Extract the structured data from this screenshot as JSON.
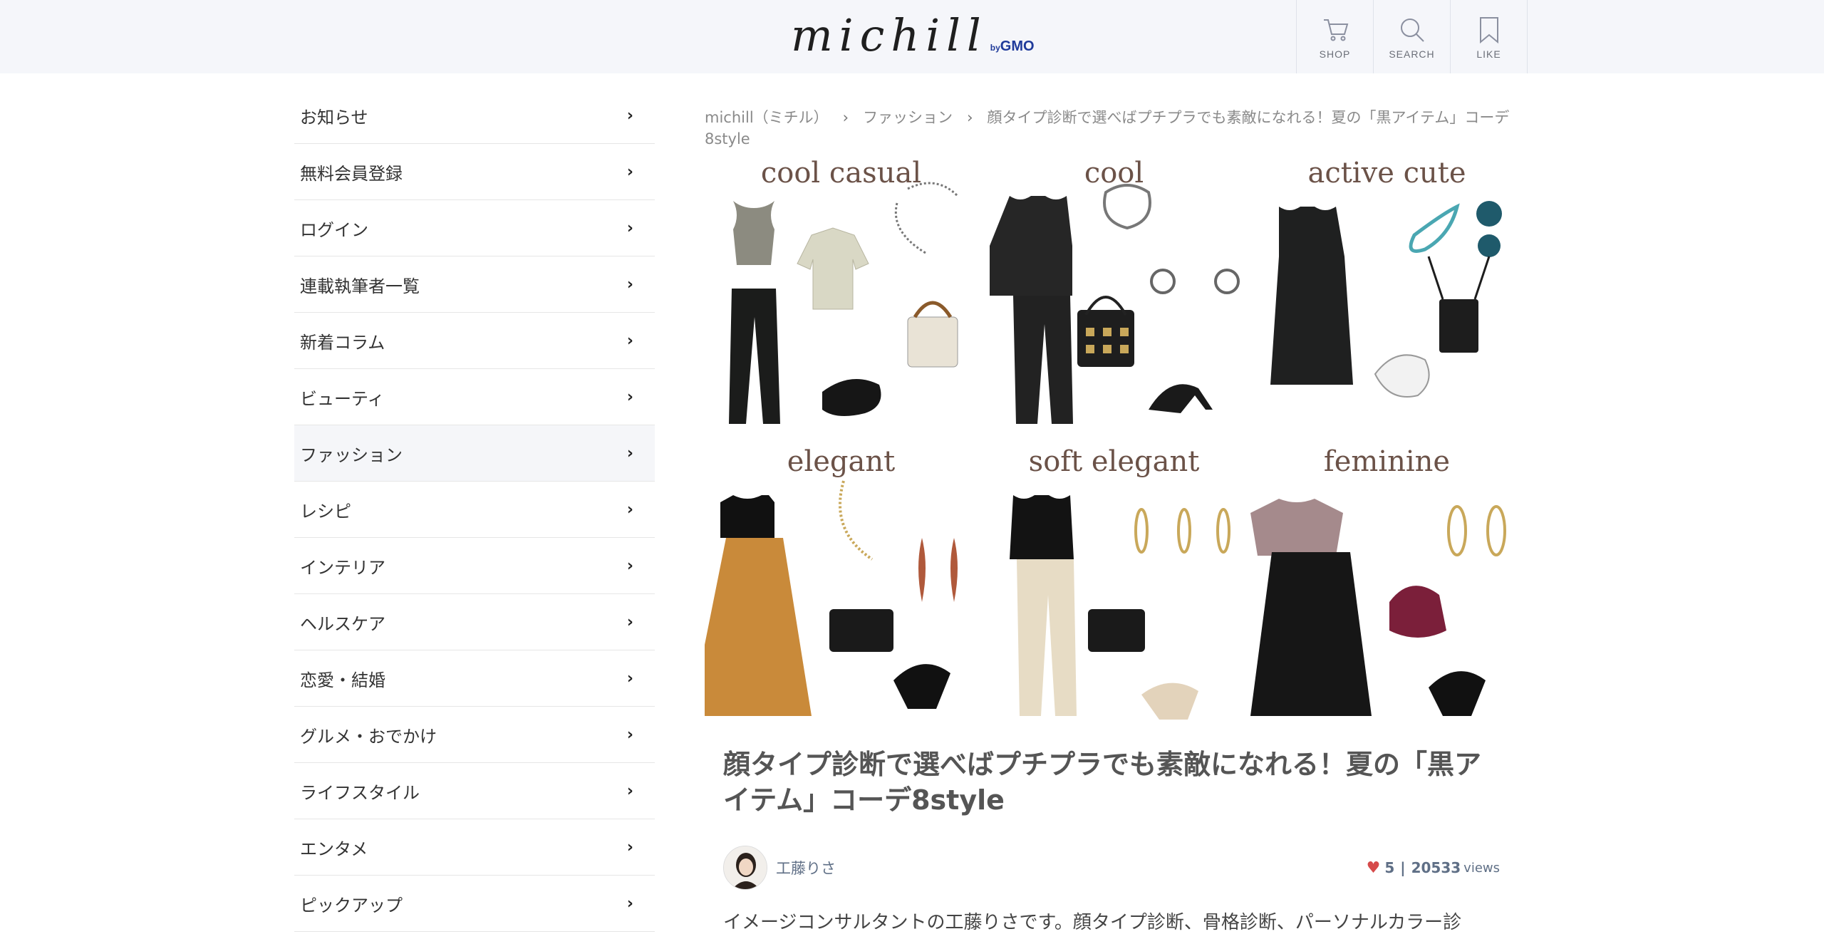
{
  "header": {
    "logo_main": "michill",
    "logo_by": "by",
    "logo_brand": "GMO",
    "buttons": [
      {
        "label": "SHOP",
        "icon": "cart-icon"
      },
      {
        "label": "SEARCH",
        "icon": "search-icon"
      },
      {
        "label": "LIKE",
        "icon": "bookmark-icon"
      }
    ]
  },
  "sidebar": {
    "items": [
      {
        "label": "お知らせ"
      },
      {
        "label": "無料会員登録"
      },
      {
        "label": "ログイン"
      },
      {
        "label": "連載執筆者一覧"
      },
      {
        "label": "新着コラム"
      },
      {
        "label": "ビューティ"
      },
      {
        "label": "ファッション",
        "active": true
      },
      {
        "label": "レシピ"
      },
      {
        "label": "インテリア"
      },
      {
        "label": "ヘルスケア"
      },
      {
        "label": "恋愛・結婚"
      },
      {
        "label": "グルメ・おでかけ"
      },
      {
        "label": "ライフスタイル"
      },
      {
        "label": "エンタメ"
      },
      {
        "label": "ピックアップ"
      }
    ],
    "chevron": "›"
  },
  "breadcrumb": {
    "home": "michill（ミチル）",
    "category": "ファッション",
    "current": "顔タイプ診断で選べばプチプラでも素敵になれる！夏の「黒アイテム」コーデ8style"
  },
  "hero": {
    "panels": [
      "cool casual",
      "cool",
      "active cute",
      "elegant",
      "soft elegant",
      "feminine"
    ]
  },
  "article": {
    "title": "顔タイプ診断で選べばプチプラでも素敵になれる！夏の「黒アイテム」コーデ8style",
    "author": "工藤りさ",
    "likes": "5",
    "separator": "|",
    "views": "20533",
    "views_label": "views",
    "intro": "イメージコンサルタントの工藤りさです。顔タイプ診断、骨格診断、パーソナルカラー診"
  },
  "colors": {
    "header_bg": "#f5f6fa",
    "accent_heart": "#d64a4a",
    "meta_text": "#5f6f86"
  }
}
